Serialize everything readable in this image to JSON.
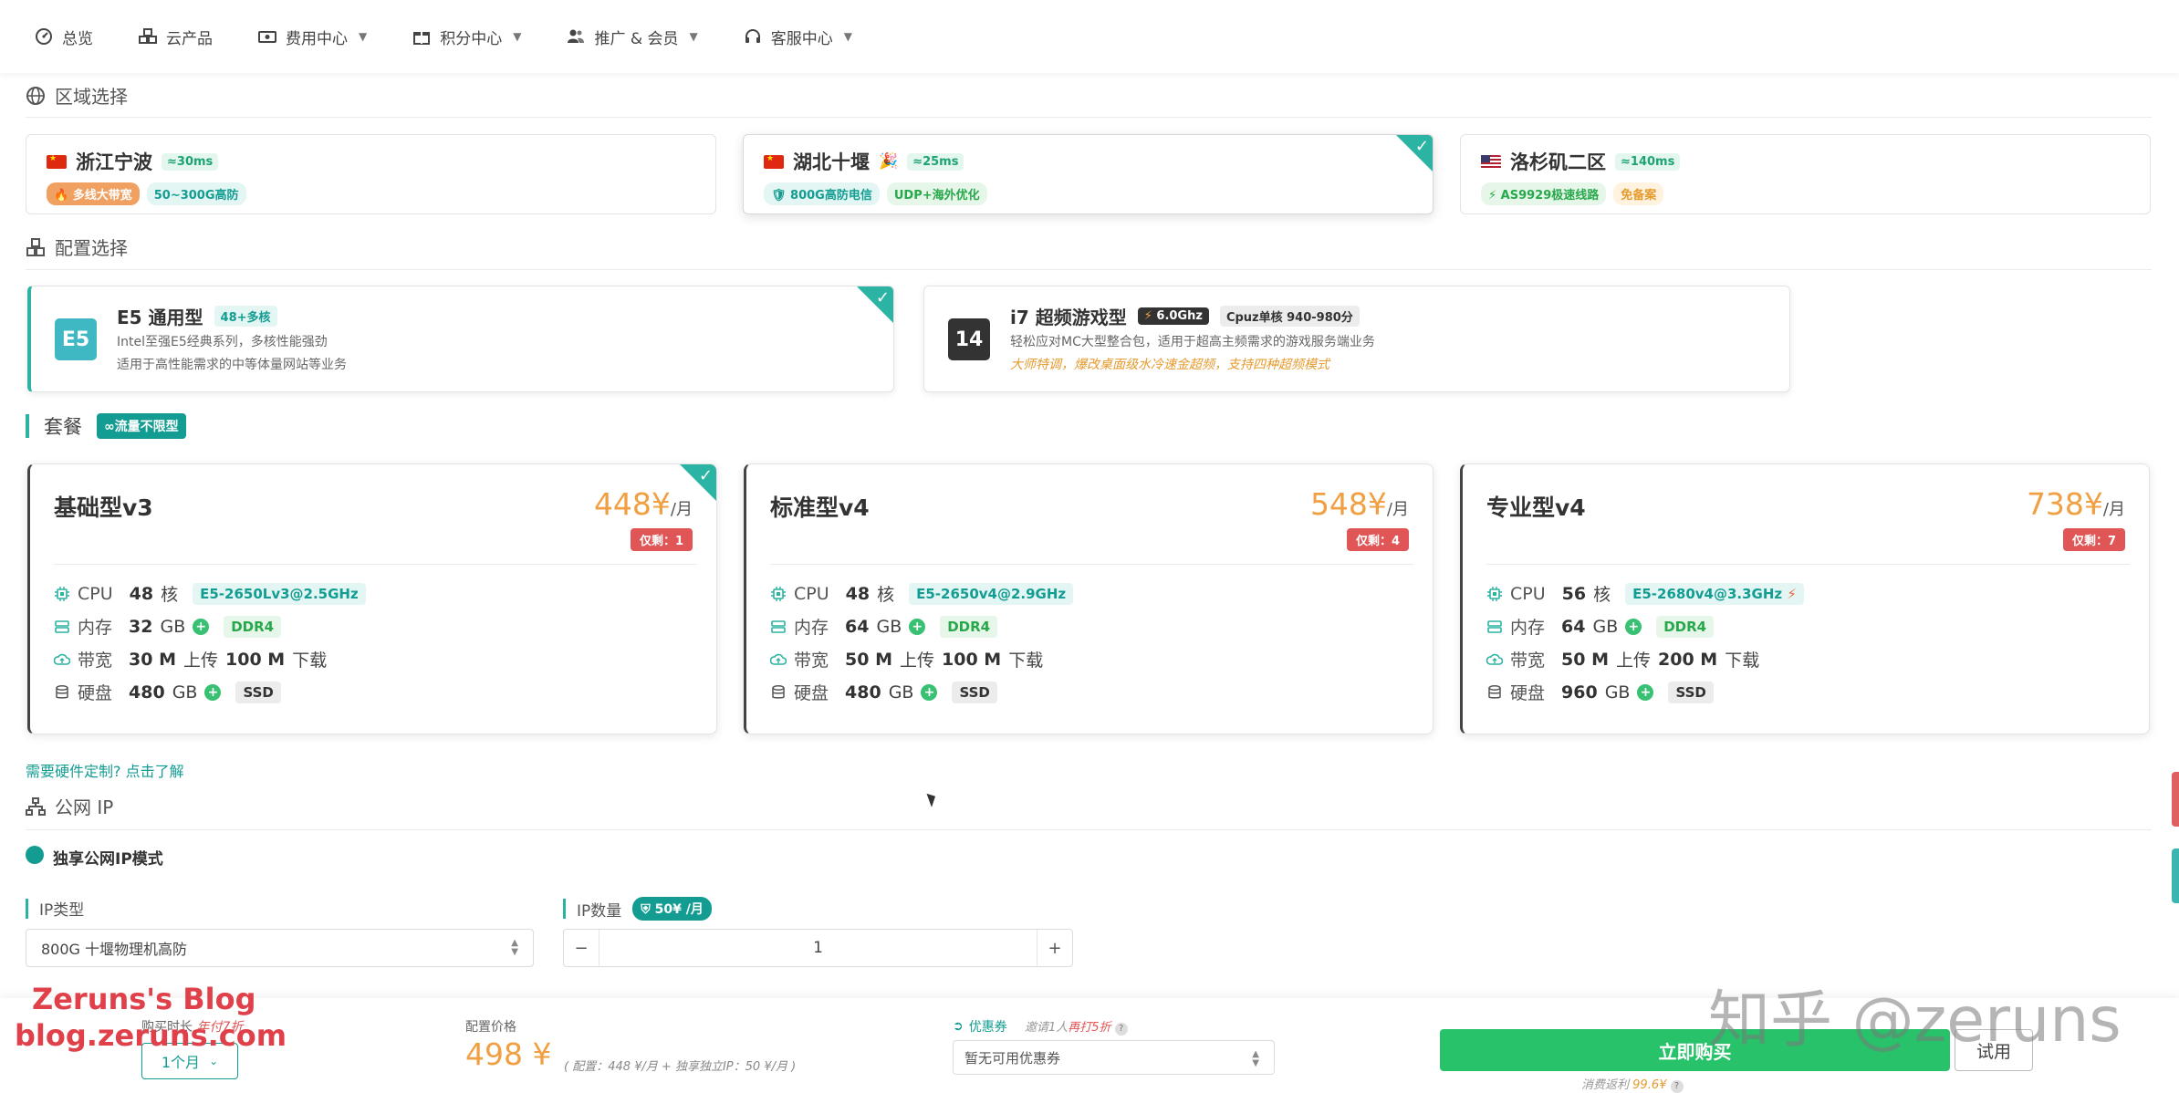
{
  "nav": {
    "items": [
      {
        "label": "总览",
        "icon": "dashboard-icon",
        "dropdown": false
      },
      {
        "label": "云产品",
        "icon": "cubes-icon",
        "dropdown": false
      },
      {
        "label": "费用中心",
        "icon": "money-icon",
        "dropdown": true
      },
      {
        "label": "积分中心",
        "icon": "gift-icon",
        "dropdown": true
      },
      {
        "label": "推广 & 会员",
        "icon": "users-icon",
        "dropdown": true
      },
      {
        "label": "客服中心",
        "icon": "headset-icon",
        "dropdown": true
      }
    ]
  },
  "region": {
    "title": "区域选择",
    "cards": [
      {
        "name": "浙江宁波",
        "ping": "≈30ms",
        "flag": "cn",
        "tags": [
          "多线大带宽",
          "50~300G高防"
        ],
        "selected": false
      },
      {
        "name": "湖北十堰",
        "ping": "≈25ms",
        "flag": "cn",
        "tags": [
          "800G高防电信",
          "UDP+海外优化"
        ],
        "selected": true
      },
      {
        "name": "洛杉矶二区",
        "ping": "≈140ms",
        "flag": "us",
        "tags": [
          "AS9929极速线路",
          "免备案"
        ],
        "selected": false
      }
    ]
  },
  "config": {
    "title": "配置选择",
    "cards": [
      {
        "badge": "E5",
        "badge_color": "#3fb8c4",
        "name": "E5 通用型",
        "tags": [
          "48+多核"
        ],
        "desc1": "Intel至强E5经典系列，多核性能强劲",
        "desc2": "适用于高性能需求的中等体量网站等业务",
        "selected": true
      },
      {
        "badge": "14",
        "badge_color": "#333333",
        "name": "i7 超频游戏型",
        "tags": [
          "6.0Ghz",
          "Cpuz单核 940-980分"
        ],
        "desc1": "轻松应对MC大型整合包，适用于超高主频需求的游戏服务端业务",
        "desc2": "大师特调，爆改桌面级水冷速金超频，支持四种超频模式",
        "selected": false
      }
    ]
  },
  "package": {
    "title": "套餐",
    "unlimited": "∞流量不限型",
    "plans": [
      {
        "name": "基础型v3",
        "price": "448¥",
        "unit": "/月",
        "remaining": "仅剩：1",
        "cpu_cores": "48",
        "cpu_unit": "核",
        "cpu_model": "E5-2650Lv3@2.5GHz",
        "ram": "32",
        "ram_unit": "GB",
        "ram_type": "DDR4",
        "up": "30 M",
        "down": "100 M",
        "disk": "480",
        "disk_unit": "GB",
        "disk_type": "SSD",
        "selected": true,
        "bolt": false
      },
      {
        "name": "标准型v4",
        "price": "548¥",
        "unit": "/月",
        "remaining": "仅剩：4",
        "cpu_cores": "48",
        "cpu_unit": "核",
        "cpu_model": "E5-2650v4@2.9GHz",
        "ram": "64",
        "ram_unit": "GB",
        "ram_type": "DDR4",
        "up": "50 M",
        "down": "100 M",
        "disk": "480",
        "disk_unit": "GB",
        "disk_type": "SSD",
        "selected": false,
        "bolt": false
      },
      {
        "name": "专业型v4",
        "price": "738¥",
        "unit": "/月",
        "remaining": "仅剩：7",
        "cpu_cores": "56",
        "cpu_unit": "核",
        "cpu_model": "E5-2680v4@3.3GHz",
        "ram": "64",
        "ram_unit": "GB",
        "ram_type": "DDR4",
        "up": "50 M",
        "down": "200 M",
        "disk": "960",
        "disk_unit": "GB",
        "disk_type": "SSD",
        "selected": false,
        "bolt": true
      }
    ],
    "labels": {
      "cpu": "CPU",
      "ram": "内存",
      "bandwidth": "带宽",
      "disk": "硬盘",
      "upload": "上传",
      "download": "下载"
    },
    "custom_link": "需要硬件定制? 点击了解"
  },
  "ip": {
    "title": "公网 IP",
    "mode": "独享公网IP模式",
    "type_label": "IP类型",
    "type_value": "800G 十堰物理机高防",
    "count_label": "IP数量",
    "count_price": "50¥ /月",
    "count_value": "1",
    "minus": "−",
    "plus": "+"
  },
  "bottom": {
    "duration_label": "购买时长",
    "duration_note": "年付7折",
    "duration_value": "1个月",
    "price_label": "配置价格",
    "total": "498 ¥",
    "price_detail": "( 配置：448 ¥/月 + 独享独立IP：50 ¥/月 )",
    "coupon_label": "优惠券",
    "coupon_invite_prefix": "邀请1人",
    "coupon_invite_highlight": "再打5折",
    "coupon_value": "暂无可用优惠券",
    "buy_label": "立即购买",
    "trial_label": "试用",
    "cashback_prefix": "消费返利",
    "cashback_value": "99.6¥"
  },
  "watermark": {
    "blog_title": "Zeruns's Blog",
    "blog_url": "blog.zeruns.com",
    "zhihu": "知乎 @zeruns"
  },
  "colors": {
    "accent": "#2bb3a3",
    "price": "#f0a042",
    "buy": "#27c269",
    "danger": "#e05555"
  }
}
